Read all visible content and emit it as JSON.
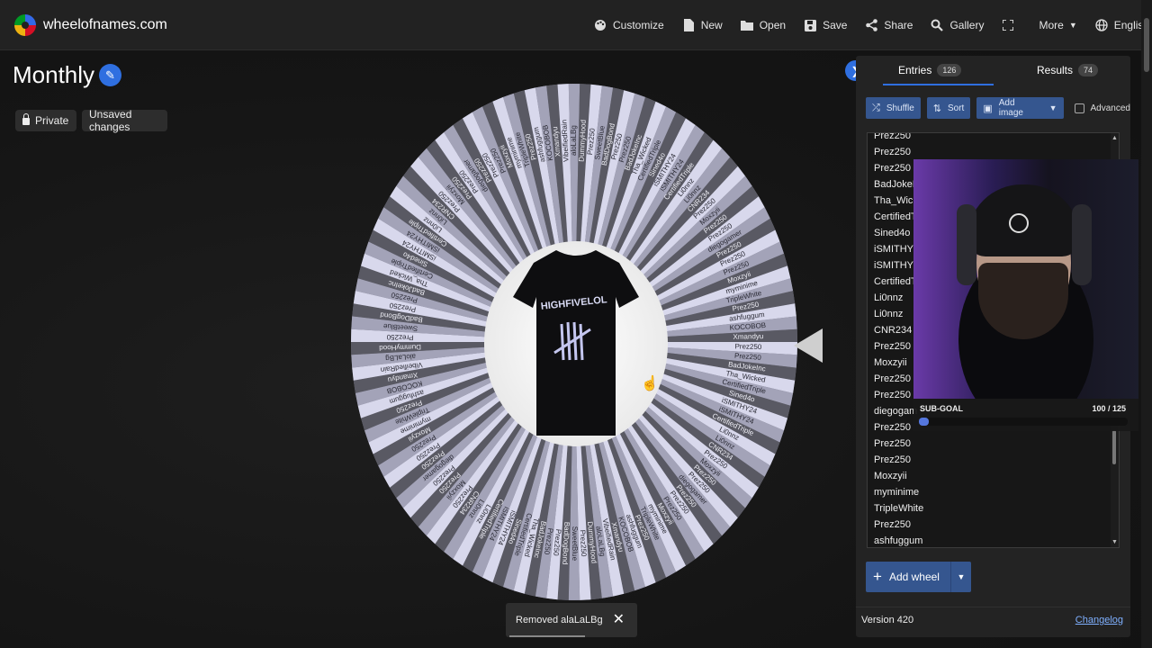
{
  "app": {
    "name": "wheelofnames.com"
  },
  "menu": [
    {
      "label": "Customize",
      "icon": "palette-icon"
    },
    {
      "label": "New",
      "icon": "file-icon"
    },
    {
      "label": "Open",
      "icon": "folder-open-icon"
    },
    {
      "label": "Save",
      "icon": "save-icon"
    },
    {
      "label": "Share",
      "icon": "share-icon"
    },
    {
      "label": "Gallery",
      "icon": "search-icon"
    },
    {
      "label": "",
      "icon": "fullscreen-icon"
    },
    {
      "label": "More",
      "icon": ""
    },
    {
      "label": "English",
      "icon": "globe-icon"
    }
  ],
  "wheel": {
    "title": "Monthly",
    "chips": {
      "private": "Private",
      "unsaved": "Unsaved changes"
    },
    "center_shirt_text": "HIGHFIVELOL",
    "slice_names": [
      "Prez250",
      "Prez250",
      "BadJokeInc",
      "Tha_Wicked",
      "CertifiedTriple",
      "Sined4o",
      "iSMITHY24",
      "iSMITHY24",
      "CertifiedTriple",
      "Li0nnz",
      "Li0nnz",
      "CNR234",
      "Prez250",
      "Moxzyii",
      "Prez250",
      "Prez250",
      "diegogamer",
      "Prez250",
      "Prez250",
      "Prez250",
      "Moxzyii",
      "myminime",
      "TripleWhite",
      "Prez250",
      "ashfuggum",
      "KOCOBOB",
      "Xmandyu",
      "VibeifiedRain",
      "aloLaLBg",
      "DummyHood",
      "Prez250",
      "SweetBlue",
      "BadDogBond"
    ]
  },
  "toast": {
    "message": "Removed alaLaLBg"
  },
  "panel": {
    "tabs": {
      "entries_label": "Entries",
      "entries_count": "126",
      "results_label": "Results",
      "results_count": "74"
    },
    "toolbar": {
      "shuffle": "Shuffle",
      "sort": "Sort",
      "add_image": "Add image",
      "advanced": "Advanced"
    },
    "entries": [
      "Prez250",
      "Prez250",
      "Prez250",
      "BadJokeIn",
      "Tha_Wick",
      "CertifiedT",
      "Sined4o",
      "iSMITHY2",
      "iSMITHY2",
      "CertifiedT",
      "Li0nnz",
      "Li0nnz",
      "CNR234",
      "Prez250",
      "Moxzyii",
      "Prez250",
      "Prez250",
      "diegogam",
      "Prez250",
      "Prez250",
      "Prez250",
      "Moxzyii",
      "myminime",
      "TripleWhite",
      "Prez250",
      "ashfuggum"
    ],
    "add_wheel": "Add wheel",
    "version": "Version 420",
    "changelog": "Changelog"
  },
  "overlay": {
    "subgoal_label": "SUB-GOAL",
    "subgoal_value": "100 / 125",
    "subgoal_fraction": 0.8
  },
  "colors": {
    "accent": "#2f6fe0",
    "button": "#35568f",
    "slice_light": "#d8d8ec",
    "slice_dark": "#595963"
  }
}
